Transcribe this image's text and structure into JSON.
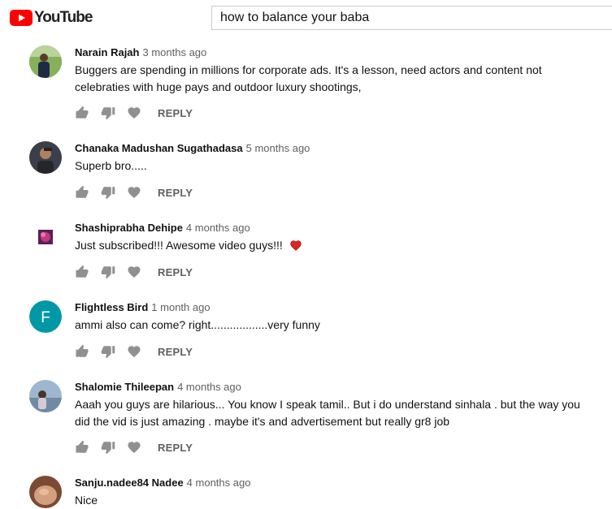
{
  "header": {
    "logo_text": "YouTube",
    "search_value": "how to balance your baba",
    "brand_color": "#ff0000"
  },
  "comments": [
    {
      "author": "Narain Rajah",
      "time": "3 months ago",
      "text": "Buggers are spending in millions for corporate ads. It's a lesson, need actors and content  not celebraties with huge pays and outdoor luxury shootings,",
      "reply_label": "REPLY"
    },
    {
      "author": "Chanaka Madushan Sugathadasa",
      "time": "5 months ago",
      "text": "Superb bro.....",
      "reply_label": "REPLY"
    },
    {
      "author": "Shashiprabha Dehipe",
      "time": "4 months ago",
      "text": "Just subscribed!!! Awesome video guys!!!",
      "reply_label": "REPLY"
    },
    {
      "author": "Flightless Bird",
      "time": "1 month ago",
      "text": "ammi also can come? right..................very funny",
      "avatar_letter": "F",
      "avatar_color": "#0097a7",
      "reply_label": "REPLY"
    },
    {
      "author": "Shalomie Thileepan",
      "time": "4 months ago",
      "text": "Aaah you guys are hilarious... You know I speak tamil.. But i do understand sinhala . but the way you did the vid is just amazing . maybe it's and advertisement but really gr8 job",
      "reply_label": "REPLY"
    },
    {
      "author": "Sanju.nadee84 Nadee",
      "time": "4 months ago",
      "text": "Nice"
    }
  ]
}
